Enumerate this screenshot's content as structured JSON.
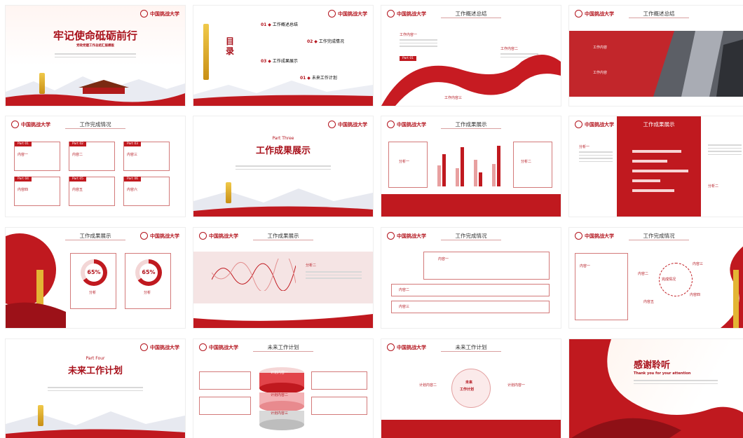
{
  "brand": {
    "logo_text": "中国挑战大学",
    "accent": "#b3141d",
    "red": "#c0191f"
  },
  "s1": {
    "title": "牢记使命砥砺前行",
    "subtitle": "党政党建工作总结汇报模板"
  },
  "s2": {
    "mark": "目录",
    "items": [
      {
        "num": "01",
        "label": "工作概述总结"
      },
      {
        "num": "02",
        "label": "工作完成情况"
      },
      {
        "num": "03",
        "label": "工作成果展示"
      },
      {
        "num": "01",
        "label": "未来工作计划"
      }
    ]
  },
  "s3": {
    "title": "工作概述总结",
    "c1": "工作内容一",
    "c2": "工作内容二",
    "c3": "工作内容三",
    "btn": "Part 01"
  },
  "s4": {
    "title": "工作概述总结",
    "c1": "工作内容",
    "c2": "工作内容"
  },
  "s5": {
    "title": "工作完成情况",
    "parts": [
      "Part 01",
      "Part 02",
      "Part 03",
      "Part 04",
      "Part 05",
      "Part 06"
    ],
    "labels": [
      "内容一",
      "内容二",
      "内容三",
      "内容四",
      "内容五",
      "内容六"
    ]
  },
  "s6": {
    "part": "Part Three",
    "title": "工作成果展示"
  },
  "s7": {
    "title": "工作成果展示",
    "a1": "分析一",
    "a2": "分析二"
  },
  "s8": {
    "title": "工作成果展示",
    "a1": "分析一",
    "a2": "分析二"
  },
  "s9": {
    "title": "工作成果展示",
    "p1": "65%",
    "p2": "65%",
    "l1": "分析",
    "l2": "分析"
  },
  "s10": {
    "title": "工作成果展示",
    "a1": "分析二"
  },
  "s11": {
    "title": "工作完成情况",
    "r1": "内容一",
    "r2": "内容二",
    "r3": "内容三"
  },
  "s12": {
    "title": "工作完成情况",
    "center": "完成情况",
    "c1": "内容一",
    "c2": "内容二",
    "c3": "内容三",
    "c4": "内容四",
    "c5": "内容五"
  },
  "s13": {
    "part": "Part Four",
    "title": "未来工作计划"
  },
  "s14": {
    "title": "未来工作计划",
    "l1": "计划内容一",
    "l2": "计划内容二",
    "l3": "计划内容三"
  },
  "s15": {
    "title": "未来工作计划",
    "center1": "未来",
    "center2": "工作计划",
    "left": "计划内容二",
    "right": "计划内容一"
  },
  "s16": {
    "title": "感谢聆听",
    "subtitle": "Thank you for your attention"
  }
}
